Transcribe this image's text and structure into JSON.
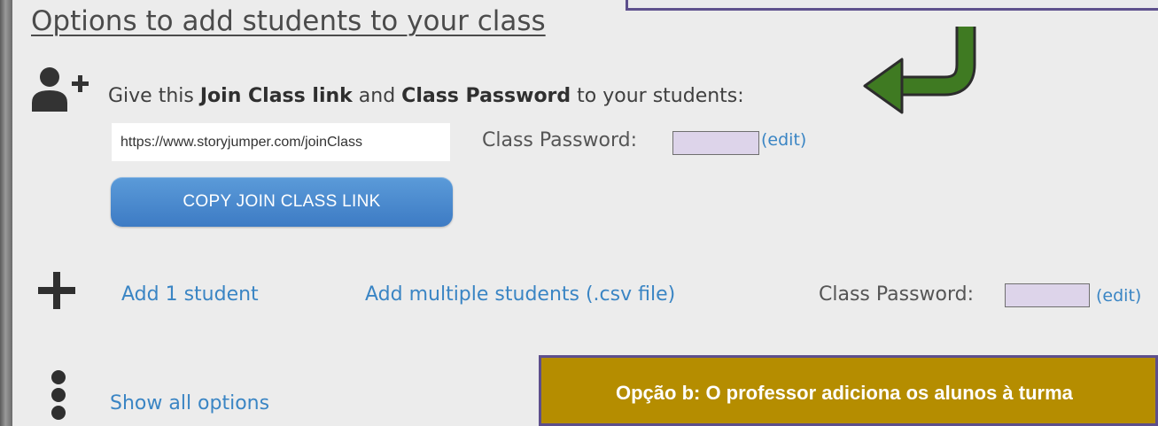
{
  "section": {
    "title": "Options to add students to your class"
  },
  "join_class": {
    "instruction_prefix": "Give this ",
    "instruction_bold1": "Join Class link",
    "instruction_middle": " and ",
    "instruction_bold2": "Class Password",
    "instruction_suffix": " to your students:",
    "link_value": "https://www.storyjumper.com/joinClass",
    "password_label": "Class Password:",
    "edit_label": "(edit)",
    "copy_button_label": "COPY JOIN CLASS LINK"
  },
  "add_students": {
    "add_one_label": "Add 1 student",
    "add_multiple_label": "Add multiple students (.csv file)",
    "password_label": "Class Password:",
    "edit_label": "(edit)"
  },
  "more_options": {
    "show_all_label": "Show all options"
  },
  "annotation": {
    "callout_text": "Opção b: O professor adiciona os alunos à turma"
  },
  "colors": {
    "panel_background": "#ececec",
    "link_blue": "#3a85c4",
    "button_blue": "#4a89cc",
    "arrow_green": "#3f7a22",
    "callout_gold": "#b58d00",
    "callout_border": "#5d4f8c",
    "password_fill": "#ddd4ea"
  },
  "icons": {
    "add_user": "user-plus-icon",
    "plus": "plus-icon",
    "more": "vertical-ellipsis-icon",
    "arrow": "curved-arrow-left-icon"
  }
}
